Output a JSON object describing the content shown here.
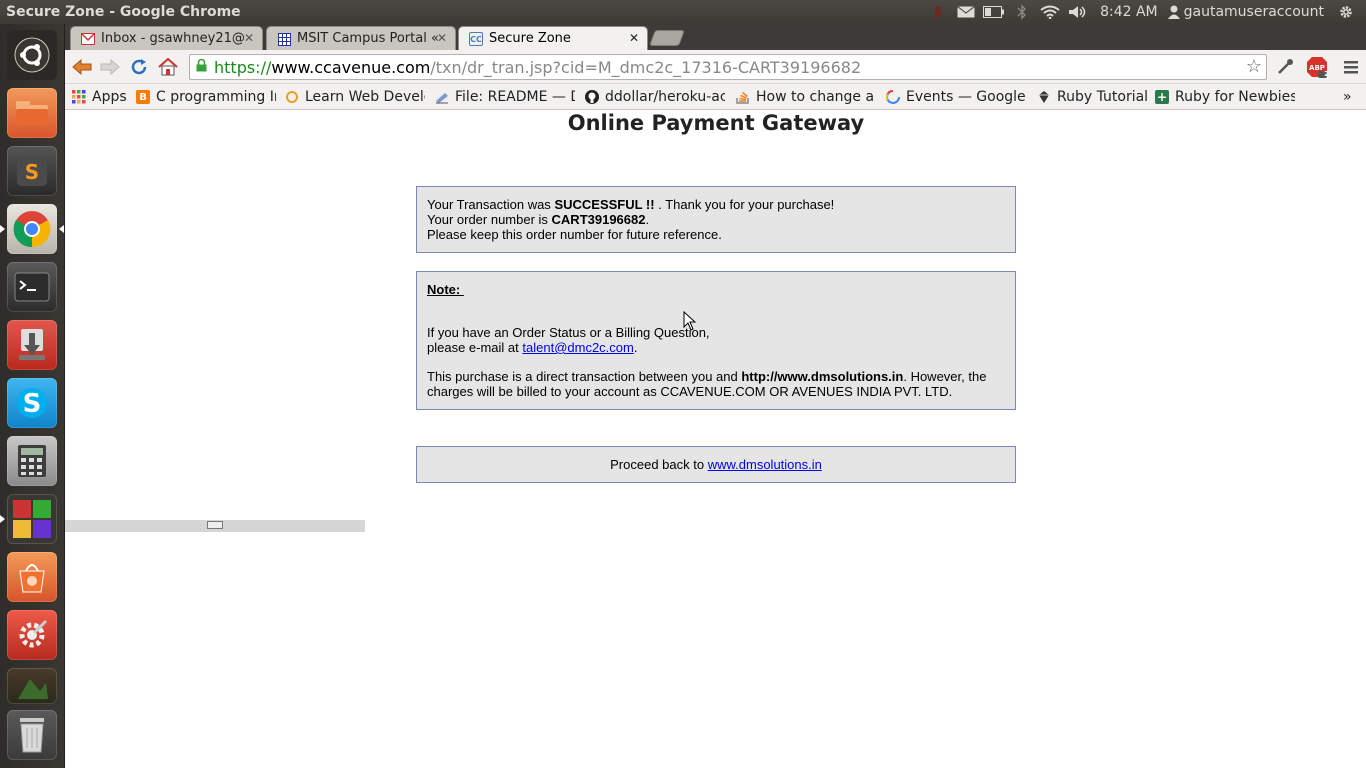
{
  "system_panel": {
    "window_title": "Secure Zone - Google Chrome",
    "clock": "8:42 AM",
    "username": "gautamuseraccount"
  },
  "tabs": [
    {
      "label": "Inbox - gsawhney21@",
      "favicon": "gmail-icon",
      "active": false
    },
    {
      "label": "MSIT Campus Portal «",
      "favicon": "grid-icon",
      "active": false
    },
    {
      "label": "Secure Zone",
      "favicon": "cc-icon",
      "active": true
    }
  ],
  "omnibox": {
    "scheme": "https://",
    "host": "www.ccavenue.com",
    "path": "/txn/dr_tran.jsp?cid=M_dmc2c_17316-CART39196682"
  },
  "extensions": {
    "abp_badge": "2"
  },
  "bookmarks": [
    {
      "label": "Apps",
      "icon": "apps-grid-icon"
    },
    {
      "label": "C programming Int",
      "icon": "blogger-icon"
    },
    {
      "label": "Learn Web Develo",
      "icon": "ring-icon"
    },
    {
      "label": "File: README — D",
      "icon": "doc-icon"
    },
    {
      "label": "ddollar/heroku-acc",
      "icon": "github-icon"
    },
    {
      "label": "How to change a G",
      "icon": "stackoverflow-icon"
    },
    {
      "label": "Events — Google D",
      "icon": "google-icon"
    },
    {
      "label": "Ruby Tutorial",
      "icon": "ruby-icon"
    },
    {
      "label": "Ruby for Newbies:",
      "icon": "plus-icon"
    }
  ],
  "page": {
    "title": "Online Payment Gateway",
    "success_box": {
      "line1_pre": "Your Transaction was ",
      "line1_bold": "SUCCESSFUL !!",
      "line1_post": " . Thank you for your purchase!",
      "line2_pre": "Your order number is ",
      "order_number": "CART39196682",
      "line2_post": ".",
      "line3": "Please keep this order number for future reference."
    },
    "note_box": {
      "heading": "Note: ",
      "line1": "If you have an Order Status or a Billing Question,",
      "line2_pre": "please e-mail at ",
      "email": "talent@dmc2c.com",
      "line2_post": ".",
      "para_pre": "This purchase is a direct transaction between you and ",
      "para_bold": "http://www.dmsolutions.in",
      "para_post": ". However, the charges will be billed to your account as CCAVENUE.COM OR AVENUES INDIA PVT. LTD."
    },
    "proceed_box": {
      "text": "Proceed back to ",
      "link": "www.dmsolutions.in"
    }
  }
}
